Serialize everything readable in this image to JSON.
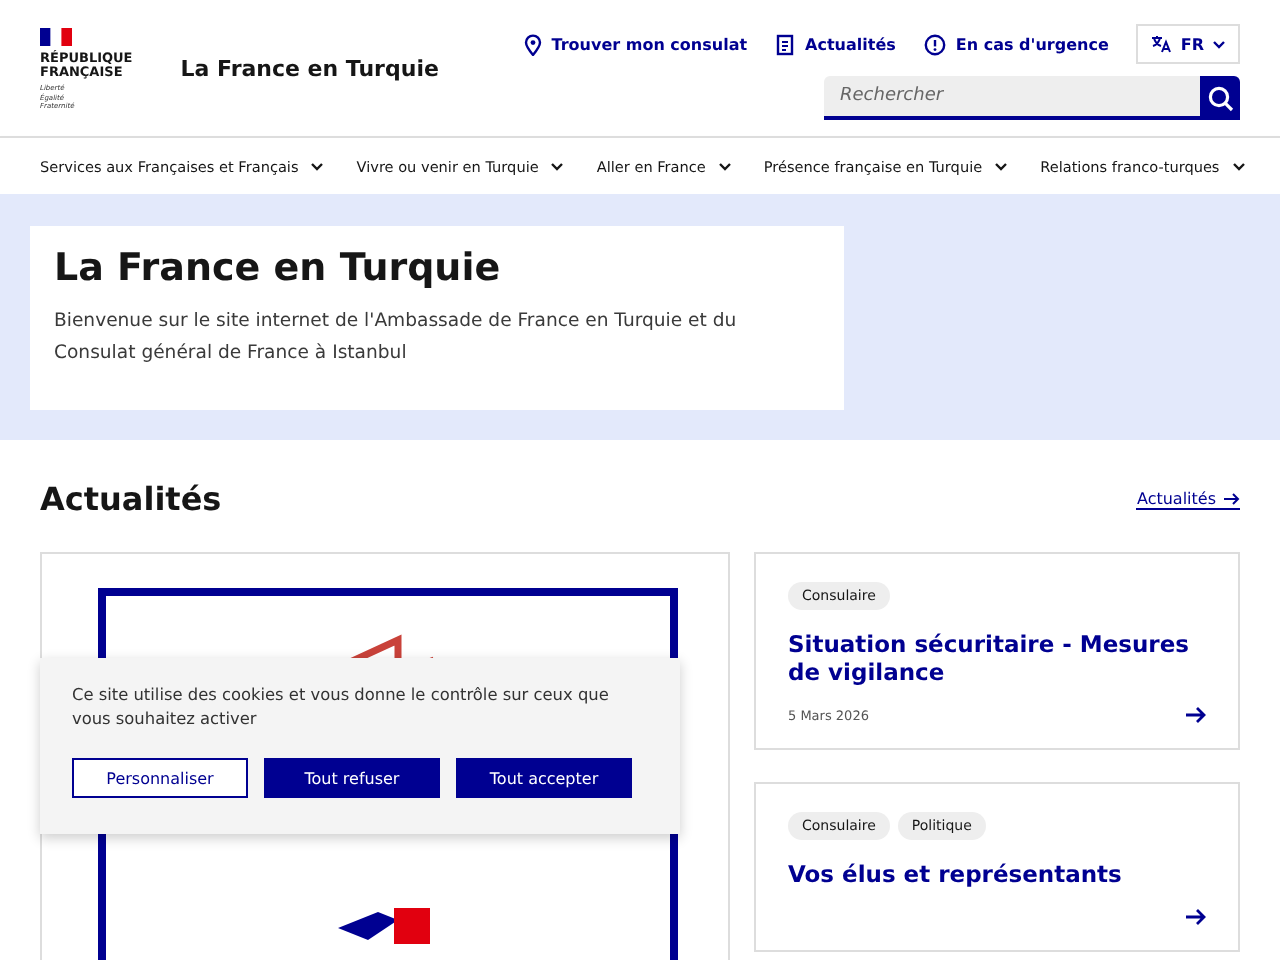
{
  "logo": {
    "lines": [
      "RÉPUBLIQUE",
      "FRANÇAISE"
    ],
    "motto": [
      "Liberté",
      "Égalité",
      "Fraternité"
    ]
  },
  "site_title": "La France en Turquie",
  "quick_links": [
    {
      "kind": "pin",
      "label": "Trouver mon consulat"
    },
    {
      "kind": "news",
      "label": "Actualités"
    },
    {
      "kind": "alert",
      "label": "En cas d'urgence"
    }
  ],
  "language": "FR",
  "search": {
    "placeholder": "Rechercher"
  },
  "nav": [
    "Services aux Françaises et Français",
    "Vivre ou venir en Turquie",
    "Aller en France",
    "Présence française en Turquie",
    "Relations franco-turques"
  ],
  "hero": {
    "title": "La France en Turquie",
    "text": "Bienvenue sur le site internet de l'Ambassade de France en Turquie et du Consulat général de France à Istanbul"
  },
  "news": {
    "heading": "Actualités",
    "link": "Actualités",
    "cards": [
      {
        "tags": [
          "Consulaire"
        ],
        "title": "Situation sécuritaire - Mesures de vigilance",
        "date": "5 Mars 2026"
      },
      {
        "tags": [
          "Consulaire",
          "Politique"
        ],
        "title": "Vos élus et représentants"
      }
    ]
  },
  "cookie_banner": {
    "text": "Ce site utilise des cookies et vous donne le contrôle sur ceux que vous souhaitez activer",
    "buttons": [
      {
        "label": "Personnaliser",
        "kind": "secondary"
      },
      {
        "label": "Tout refuser",
        "kind": "primary"
      },
      {
        "label": "Tout accepter",
        "kind": "primary"
      }
    ]
  }
}
